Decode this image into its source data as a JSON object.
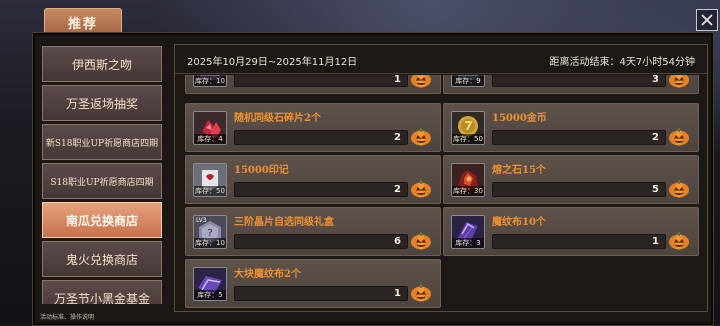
{
  "title_tab": "推荐",
  "sidebar": {
    "items": [
      {
        "label": "伊西斯之吻",
        "active": false
      },
      {
        "label": "万圣返场抽奖",
        "active": false
      },
      {
        "label": "新S18职业UP祈愿商店四期",
        "active": false
      },
      {
        "label": "S18职业UP祈愿商店四期",
        "active": false
      },
      {
        "label": "南瓜兑换商店",
        "active": true
      },
      {
        "label": "鬼火兑换商店",
        "active": false
      },
      {
        "label": "万圣节小黑金基金",
        "active": false
      }
    ],
    "bottom_note": "活动标准、操作说明"
  },
  "header": {
    "date_range": "2025年10月29日~2025年11月12日",
    "countdown": "距离活动结束：4天7小时54分钟"
  },
  "items": [
    {
      "name": "",
      "stock": "库存：10",
      "price": "1",
      "icon": "partial-item-icon"
    },
    {
      "name": "",
      "stock": "库存：9",
      "price": "3",
      "icon": "partial-item-icon"
    },
    {
      "name": "随机同级石碎片2个",
      "stock": "库存：4",
      "price": "2",
      "icon": "red-stone-shard-icon"
    },
    {
      "name": "15000金币",
      "stock": "库存：50",
      "price": "2",
      "icon": "gold-coin-icon"
    },
    {
      "name": "15000印记",
      "stock": "库存：50",
      "price": "2",
      "icon": "seal-mark-icon"
    },
    {
      "name": "熔之石15个",
      "stock": "库存：30",
      "price": "5",
      "icon": "molten-stone-icon"
    },
    {
      "name": "三阶晶片自选同级礼盒",
      "stock": "库存：10",
      "price": "6",
      "icon": "mystery-box-icon",
      "level": "LV3"
    },
    {
      "name": "魔纹布10个",
      "stock": "库存：3",
      "price": "1",
      "icon": "magic-cloth-icon"
    },
    {
      "name": "大块魔纹布2个",
      "stock": "库存：5",
      "price": "1",
      "icon": "large-magic-cloth-icon"
    }
  ],
  "colors": {
    "accent": "#f0912f",
    "tab_active": "#d98a62",
    "card": "#574b44"
  }
}
